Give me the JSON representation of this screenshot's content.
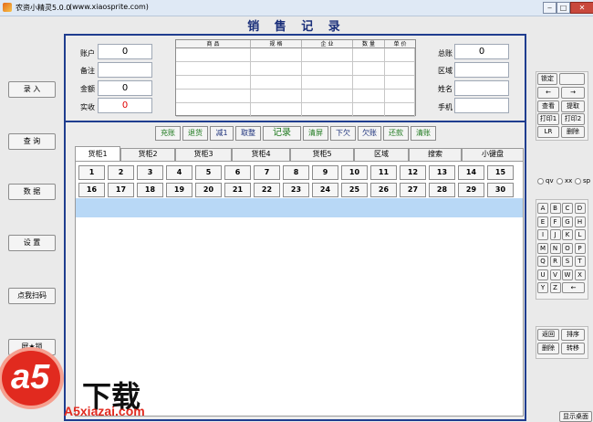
{
  "window": {
    "title": "农资小精灵5.0.0",
    "url": "(www.xiaosprite.com)",
    "controls": {
      "minimize": "‒",
      "maximize": "□",
      "close": "✕"
    }
  },
  "page_title": "销 售 记 录",
  "left_menu": [
    "录 入",
    "查 询",
    "数 据",
    "设 置",
    "点我扫码",
    "屏★锁"
  ],
  "form": {
    "left_fields": [
      {
        "label": "账户",
        "value": "0"
      },
      {
        "label": "备注",
        "value": ""
      },
      {
        "label": "金额",
        "value": "0"
      },
      {
        "label": "实收",
        "value": "0"
      }
    ],
    "right_fields": [
      {
        "label": "总账",
        "value": "0"
      },
      {
        "label": "区域",
        "value": ""
      },
      {
        "label": "姓名",
        "value": ""
      },
      {
        "label": "手机",
        "value": ""
      }
    ],
    "item_table": {
      "columns": [
        "商  品",
        "规  格",
        "企  业",
        "数  量",
        "单  价"
      ]
    }
  },
  "actions": [
    "充账",
    "退货",
    "减1",
    "取整",
    "记录",
    "清屏",
    "下欠",
    "欠账",
    "还款",
    "清账"
  ],
  "tabs": [
    "货柜1",
    "货柜2",
    "货柜3",
    "货柜4",
    "货柜5",
    "区域",
    "搜索",
    "小键盘"
  ],
  "numbers_row1": [
    "1",
    "2",
    "3",
    "4",
    "5",
    "6",
    "7",
    "8",
    "9",
    "10",
    "11",
    "12",
    "13",
    "14",
    "15"
  ],
  "numbers_row2": [
    "16",
    "17",
    "18",
    "19",
    "20",
    "21",
    "22",
    "23",
    "24",
    "25",
    "26",
    "27",
    "28",
    "29",
    "30"
  ],
  "right_panel": {
    "lock": "锁定",
    "left_arrow": "←",
    "right_arrow": "→",
    "view": "查看",
    "extract": "提取",
    "print1": "打印1",
    "print2": "打印2",
    "lr": "LR",
    "delete": "删除"
  },
  "input_modes": [
    "qv",
    "xx",
    "sp"
  ],
  "keyboard": [
    "A",
    "B",
    "C",
    "D",
    "E",
    "F",
    "G",
    "H",
    "I",
    "J",
    "K",
    "L",
    "M",
    "N",
    "O",
    "P",
    "Q",
    "R",
    "S",
    "T",
    "U",
    "V",
    "W",
    "X",
    "Y",
    "Z",
    "←"
  ],
  "bottom_right": {
    "back": "返回",
    "sort": "排序",
    "delete": "删除",
    "transfer": "转移"
  },
  "show_desktop": "显示桌面",
  "watermark": {
    "brand": "下载",
    "site": "A5xiazai.com",
    "mark": "a5"
  },
  "colors": {
    "title": "#1a2f7a",
    "panel_border": "#1f3d8f",
    "action_green": "#1f7a1f",
    "highlight": "#b8d8f6",
    "zero_red": "#e00000"
  }
}
